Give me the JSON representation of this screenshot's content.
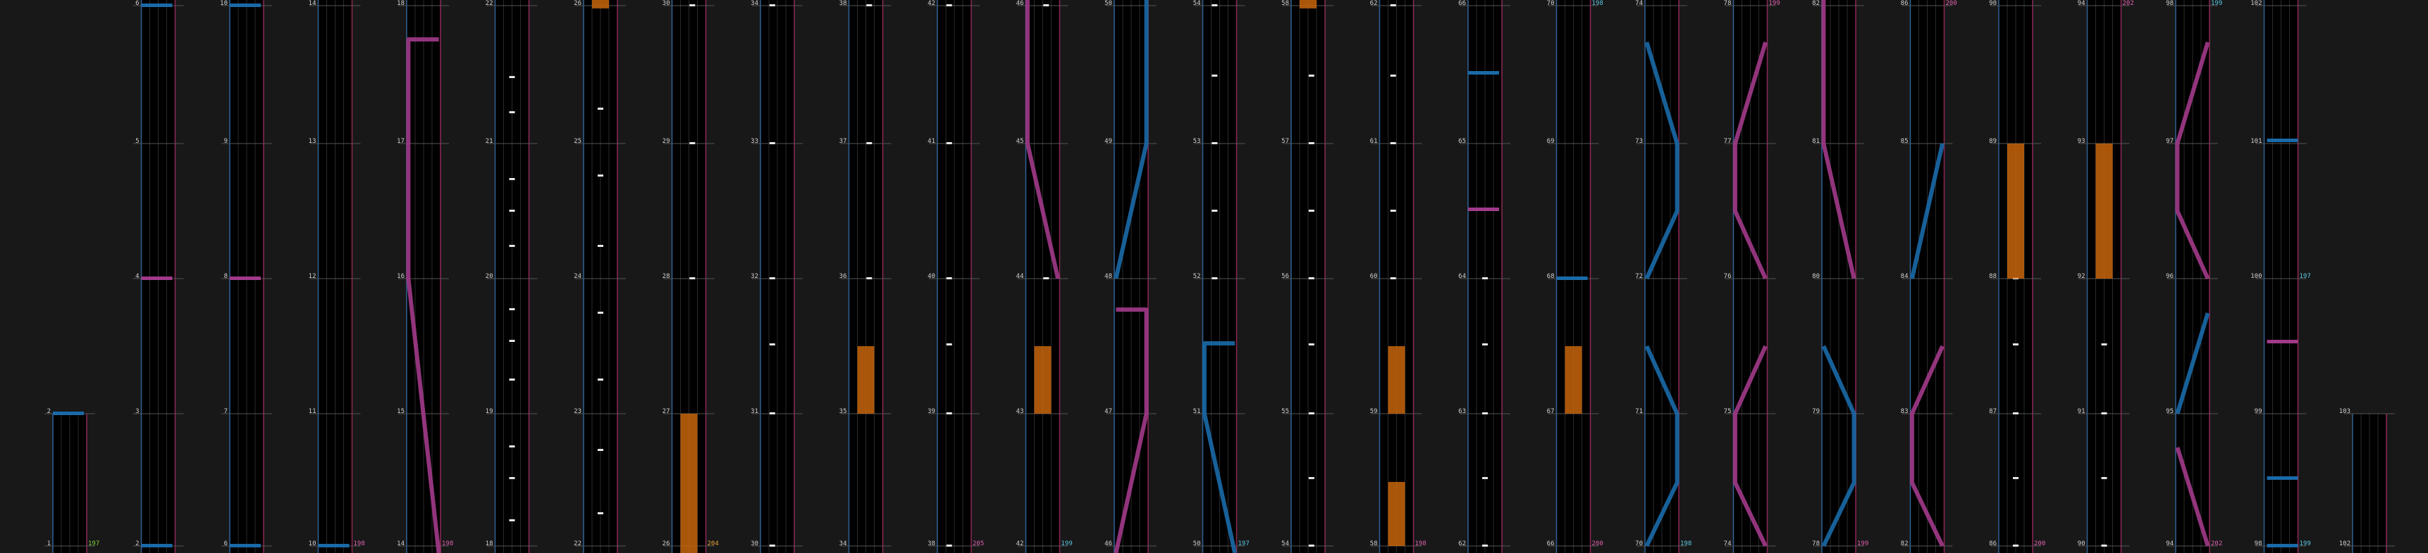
{
  "colors": {
    "background": "#181818",
    "lane": "#000000",
    "grid_line": "#555555",
    "left_edge": "#3a78b8",
    "right_edge": "#b0306a",
    "cyan_slide": "#1a6aa8",
    "pink_slide": "#a23a8a",
    "hold_orange": "#c8650c",
    "tap_white": "#e6e6e6",
    "label": "#cfcfcf",
    "combo_green": "#7ccf3a",
    "combo_cyan": "#5ac8e6",
    "combo_pink": "#e060b0",
    "combo_orange": "#e8a23a"
  },
  "columns": [
    {
      "id": "col-1",
      "measures": [
        "1",
        "2"
      ],
      "combo": {
        "text": "197",
        "color": "combo_green"
      },
      "partial": true
    },
    {
      "id": "col-2",
      "measures": [
        "2",
        "3",
        "4",
        "5",
        "6"
      ]
    },
    {
      "id": "col-3",
      "measures": [
        "6",
        "7",
        "8",
        "9",
        "10"
      ]
    },
    {
      "id": "col-4",
      "measures": [
        "10",
        "11",
        "12",
        "13",
        "14"
      ],
      "combo": {
        "text": "198",
        "color": "combo_pink"
      }
    },
    {
      "id": "col-5",
      "measures": [
        "14",
        "15",
        "16",
        "17",
        "18"
      ],
      "combo": {
        "text": "198",
        "color": "combo_pink"
      }
    },
    {
      "id": "col-6",
      "measures": [
        "18",
        "19",
        "20",
        "21",
        "22"
      ]
    },
    {
      "id": "col-7",
      "measures": [
        "22",
        "23",
        "24",
        "25",
        "26"
      ]
    },
    {
      "id": "col-8",
      "measures": [
        "26",
        "27",
        "28",
        "29",
        "30"
      ],
      "combo": {
        "text": "204",
        "color": "combo_orange"
      }
    },
    {
      "id": "col-9",
      "measures": [
        "30",
        "31",
        "32",
        "33",
        "34"
      ]
    },
    {
      "id": "col-10",
      "measures": [
        "34",
        "35",
        "36",
        "37",
        "38"
      ]
    },
    {
      "id": "col-11",
      "measures": [
        "38",
        "39",
        "40",
        "41",
        "42"
      ],
      "combo": {
        "text": "205",
        "color": "combo_pink"
      }
    },
    {
      "id": "col-12",
      "measures": [
        "42",
        "43",
        "44",
        "45",
        "46"
      ],
      "combo": {
        "text": "199",
        "color": "combo_cyan"
      }
    },
    {
      "id": "col-13",
      "measures": [
        "46",
        "47",
        "48",
        "49",
        "50"
      ]
    },
    {
      "id": "col-14",
      "measures": [
        "50",
        "51",
        "52",
        "53",
        "54"
      ],
      "combo": {
        "text": "197",
        "color": "combo_cyan"
      }
    },
    {
      "id": "col-15",
      "measures": [
        "54",
        "55",
        "56",
        "57",
        "58"
      ]
    },
    {
      "id": "col-16",
      "measures": [
        "58",
        "59",
        "60",
        "61",
        "62"
      ],
      "combo": {
        "text": "198",
        "color": "combo_pink"
      }
    },
    {
      "id": "col-17",
      "measures": [
        "62",
        "63",
        "64",
        "65",
        "66"
      ]
    },
    {
      "id": "col-18",
      "measures": [
        "66",
        "67",
        "68",
        "69",
        "70"
      ],
      "combo": {
        "text": "200",
        "color": "combo_pink"
      },
      "top_combo": {
        "text": "198",
        "color": "combo_cyan"
      }
    },
    {
      "id": "col-19",
      "measures": [
        "70",
        "71",
        "72",
        "73",
        "74"
      ],
      "combo": {
        "text": "198",
        "color": "combo_cyan"
      }
    },
    {
      "id": "col-20",
      "measures": [
        "74",
        "75",
        "76",
        "77",
        "78"
      ],
      "top_combo": {
        "text": "199",
        "color": "combo_pink"
      }
    },
    {
      "id": "col-21",
      "measures": [
        "78",
        "79",
        "80",
        "81",
        "82"
      ],
      "combo": {
        "text": "199",
        "color": "combo_pink"
      }
    },
    {
      "id": "col-22",
      "measures": [
        "82",
        "83",
        "84",
        "85",
        "86"
      ],
      "top_combo": {
        "text": "200",
        "color": "combo_pink"
      }
    },
    {
      "id": "col-23",
      "measures": [
        "86",
        "87",
        "88",
        "89",
        "90"
      ],
      "combo": {
        "text": "200",
        "color": "combo_pink"
      }
    },
    {
      "id": "col-24",
      "measures": [
        "90",
        "91",
        "92",
        "93",
        "94"
      ],
      "top_combo": {
        "text": "202",
        "color": "combo_pink"
      }
    },
    {
      "id": "col-25",
      "measures": [
        "94",
        "95",
        "96",
        "97",
        "98"
      ],
      "combo": {
        "text": "202",
        "color": "combo_pink"
      },
      "top_combo": {
        "text": "199",
        "color": "combo_cyan"
      }
    },
    {
      "id": "col-26",
      "measures": [
        "98",
        "99",
        "100",
        "101",
        "102"
      ],
      "combo": {
        "text": "199",
        "color": "combo_cyan"
      },
      "mid_combo": {
        "text": "197",
        "color": "combo_cyan"
      }
    },
    {
      "id": "col-27",
      "measures": [
        "102",
        "103"
      ],
      "partial": true
    }
  ]
}
